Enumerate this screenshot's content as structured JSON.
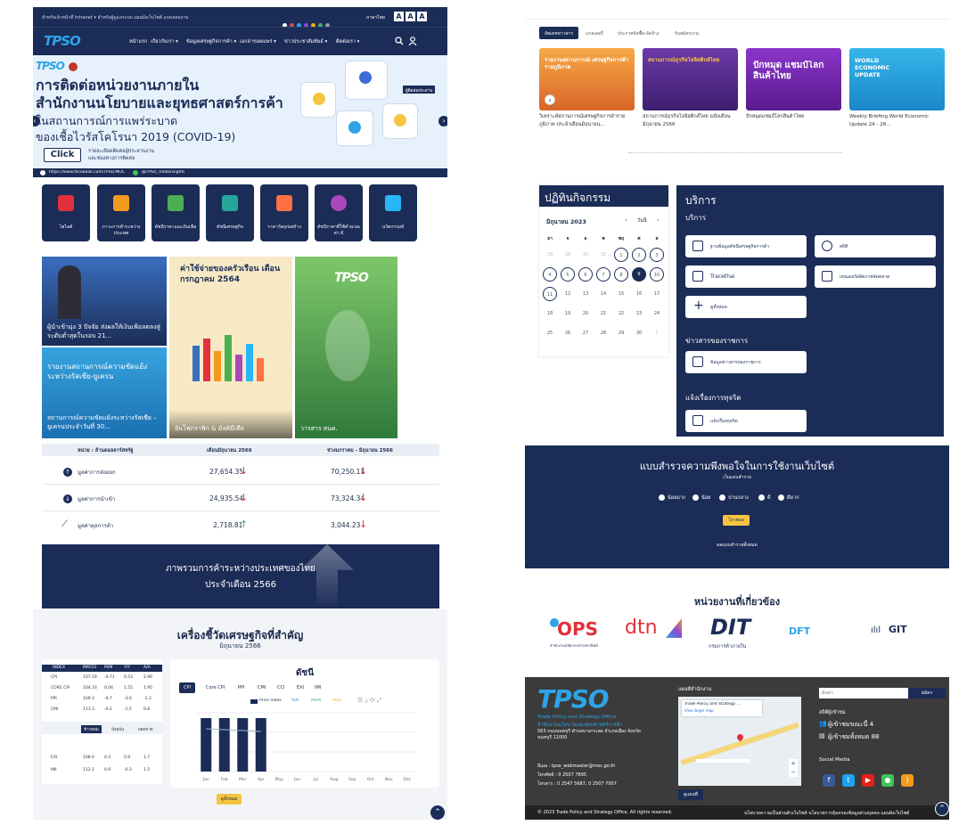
{
  "left": {
    "topbar": {
      "links": "สำหรับเจ้าหน้าที่ Intranet  ▾  สำหรับผู้ดูแลระบบ  แผนผังเว็บไซต์  แบบสอบถาม",
      "lang": "ภาษาไทย",
      "size_a1": "A",
      "size_a2": "A",
      "size_a3": "A"
    },
    "nav": {
      "logo": "TPSO",
      "items": [
        "หน้าแรก",
        "เกี่ยวกับเรา ▾",
        "ข้อมูลเศรษฐกิจการค้า ▾",
        "เอกสารเผยแพร่ ▾",
        "ข่าวประชาสัมพันธ์ ▾",
        "ติดต่อเรา ▾"
      ]
    },
    "hero": {
      "logo": "TPSO",
      "line1": "การติดต่อหน่วยงานภายใน",
      "line2": "สำนักงานนโยบายและยุทธศาสตร์การค้า",
      "line3": "ในสถานการณ์การแพร่ระบาด",
      "line4": "ของเชื้อไวรัสโคโรนา 2019 (COVID-19)",
      "click": "Click",
      "click_desc1": "รายละเอียดติดต่อผู้ประสานงาน",
      "click_desc2": "และช่องทางการติดต่อ",
      "facebook": "https://www.facebook.com/TPSO.MOC",
      "line": "@TPSO_Tradeinsights",
      "badge": "ผู้ติดต่อประสาน"
    },
    "quick_links": [
      {
        "label": "ไฮไลต์",
        "color": "#e0313c"
      },
      {
        "label": "ภาวะการค้าระหว่างประเทศ",
        "color": "#f29a1f"
      },
      {
        "label": "ดัชนีราคาและเงินเฟ้อ",
        "color": "#4caf50"
      },
      {
        "label": "ดัชนีเศรษฐกิจ",
        "color": "#26a69a"
      },
      {
        "label": "ราคาวัตถุก่อสร้าง",
        "color": "#ff7043"
      },
      {
        "label": "ดัชนีราคาที่ใช้คำนวณค่า K",
        "color": "#ab47bc"
      },
      {
        "label": "นวัตกรรมห์",
        "color": "#29b6f6"
      }
    ],
    "news": {
      "n1_title": "ผู้นำเข้ามุ่ง 3 ปัจจัย ส่งผลให้เงินเฟ้อลดลงสู่ระดับต่ำสุดในรอบ 21...",
      "n2_title": "สถานการณ์ความขัดแย้งระหว่างรัสเซีย – ยูเครนประจำวันที่ 30...",
      "n2_head": "รายงานสถานการณ์ความขัดแย้งระหว่างรัสเซีย-ยูเครน",
      "n3_title": "อินโฟกราฟิก & มัลติมีเดีย",
      "n3_head": "ค่าใช้จ่ายของครัวเรือน เดือนกรกฎาคม 2564",
      "n4_title": "วารสาร สนค.",
      "n4_logo": "TPSO"
    },
    "trade_table": {
      "unit": "หน่วย : ล้านดอลลาร์สหรัฐ",
      "col1": "เดือนมิถุนายน 2566",
      "col2": "ช่วงมกราคม - มิถุนายน 2566",
      "rows": [
        {
          "label": "มูลค่าการส่งออก",
          "v1": "27,654.35",
          "v2": "70,250.11",
          "d1": "down",
          "d2": "down"
        },
        {
          "label": "มูลค่าการนำเข้า",
          "v1": "24,935.54",
          "v2": "73,324.34",
          "d1": "down",
          "d2": "down"
        },
        {
          "label": "มูลค่าดุลการค้า",
          "v1": "2,718.81",
          "v2": "3,044.23",
          "d1": "up",
          "d2": "down"
        }
      ]
    },
    "banner2": {
      "line1": "ภาพรวมการค้าระหว่างประเทศของไทย",
      "line2": "ประจำเดือน 2566"
    },
    "econ": {
      "title": "เครื่องชี้วัดเศรษฐกิจที่สำคัญ",
      "subtitle": "มิถุนายน 2566",
      "index_title": "ดัชนี",
      "tabs": [
        "CPI",
        "Core CPI",
        "PPI",
        "CMI",
        "CCI",
        "EXI",
        "IMI"
      ],
      "legend": [
        "Price Index",
        "YOY",
        "MOM",
        "AOA"
      ],
      "months": [
        "Jan",
        "Feb",
        "Mar",
        "Apr",
        "May",
        "Jun",
        "Jul",
        "Aug",
        "Sep",
        "Oct",
        "Nov",
        "Dec"
      ],
      "more": "ดูทั้งหมด",
      "mini_headers": [
        "INDEX",
        "MAY23",
        "M/M",
        "Y/Y",
        "A/A"
      ],
      "mini_rows": [
        [
          "CPI",
          "107.19",
          "-0.71",
          "0.53",
          "2.96"
        ],
        [
          "CORE CPI",
          "104.33",
          "0.06",
          "1.55",
          "1.95"
        ],
        [
          "PPI",
          "109.3",
          "-0.7",
          "-3.0",
          "-1.3"
        ],
        [
          "CMI",
          "113.3",
          "-0.2",
          "-1.5",
          "0.8"
        ]
      ],
      "mini_tabs": [
        "ข้าวหอม",
        "ปัจจุบัน",
        "ยอดขาย"
      ],
      "mini_rows2": [
        [
          "EXI",
          "108.0",
          "0.4",
          "0.9",
          "1.7"
        ],
        [
          "IMI",
          "112.1",
          "0.9",
          "-0.3",
          "1.5"
        ]
      ]
    }
  },
  "right": {
    "tabs": [
      "อัพเดทข่าวสาร",
      "แกลเลอรี่",
      "ประกาศจัดซื้อ-จัดจ้าง",
      "รับสมัครงาน"
    ],
    "cards": [
      {
        "title": "วิเคราะห์สถานการณ์เศรษฐกิจการค้ารายภูมิภาค ประจำเดือนมิถุนายน...",
        "img_text": "รายงานสถานการณ์ เศรษฐกิจการค้ารายภูมิภาค",
        "color": "#f28b2e"
      },
      {
        "title": "สถานการณ์ธุรกิจโลจิสติกส์ไทย ฉบับเดือนมิถุนายน 2566",
        "img_text": "สถานการณ์ธุรกิจโลจิสติกส์ไทย",
        "color": "#5b2d8e"
      },
      {
        "title": "ปักหมุดแชมป์โลกสินค้าไทย",
        "img_text": "ปักหมุด แชมป์โลก สินค้าไทย",
        "color": "#7b2bb5"
      },
      {
        "title": "Weekly Briefing World Economic Update 24 - 28...",
        "img_text": "WORLD ECONOMIC UPDATE",
        "color": "#2aa7e0"
      }
    ],
    "calendar": {
      "title": "ปฏิทินกิจกรรม",
      "month": "มิถุนายน 2023",
      "today": "วันนี้",
      "dows": [
        "อา",
        "จ",
        "อ",
        "พ",
        "พฤ",
        "ศ",
        "ส"
      ],
      "days": [
        "28",
        "29",
        "30",
        "31",
        "1",
        "2",
        "3",
        "4",
        "5",
        "6",
        "7",
        "8",
        "9",
        "10",
        "11",
        "12",
        "13",
        "14",
        "15",
        "16",
        "17",
        "18",
        "19",
        "20",
        "21",
        "22",
        "23",
        "24",
        "25",
        "26",
        "27",
        "28",
        "29",
        "30",
        "1"
      ]
    },
    "services": {
      "title": "บริการ",
      "sub1": "บริการ",
      "items": [
        "ฐานข้อมูลดัชนีเศรษฐกิจการค้า",
        "สถิติ",
        "Tracethai",
        "เทนเดอร์ผลิตภาพจัดตลาด",
        "ดูทั้งหมด"
      ],
      "sub2": "ข่าวสารของราชการ",
      "item2": "ข้อมูลข่าวสารของราชการ",
      "sub3": "แจ้งเรื่องการทุจริต",
      "item3": "แจ้งเรื่องทุจริต"
    },
    "survey": {
      "title": "แบบสำรวจความพึงพอใจในการใช้งานเว็บไซต์",
      "subtitle": "เว็บแบบสำรวจ",
      "options": [
        "น้อยมาก",
        "น้อย",
        "ปานกลาง",
        "ดี",
        "ดีมาก"
      ],
      "submit": "โหวตผล",
      "result": "ผลแบบสำรวจทั้งหมด"
    },
    "partners": {
      "title": "หน่วยงานที่เกี่ยวข้อง",
      "logos": [
        "OPS",
        "dtn",
        "DIT",
        "DFT",
        "GIT"
      ],
      "ops_caption": "สำนักงานปลัดกระทรวงพาณิชย์",
      "dit_caption": "กรมการค้าภายใน"
    },
    "footer": {
      "logo": "TPSO",
      "org_en": "Trade Policy and Strategy Office",
      "org_th": "สำนักงานนโยบายและยุทธศาสตร์การค้า",
      "address": "563 ถนนนนทบุรี ตำบลบางกระสอ อำเภอเมือง จังหวัดนนทบุรี 11000",
      "email": "อีเมล : tpso_webmaster@moc.go.th",
      "phone": "โทรศัพท์ : 0 2507 7895",
      "fax": "โทรสาร : 0 2547 5687, 0 2507 7007",
      "map_title": "แผนที่สำนักงาน",
      "map_place": "Trade Policy and Strategy ...",
      "map_link": "View larger map",
      "map_btn": "ดูแผนที่",
      "search_placeholder": "ค้นหา",
      "subscribe": "สมัคร",
      "stats_title": "สถิติผู้เข้าชม",
      "online": "ผู้เข้าชมขณะนี้ 4",
      "total": "ผู้เข้าชมทั้งหมด 88",
      "social": "Social Media",
      "copyright": "© 2023 Trade Policy and Strategy Office. All rights reserved.",
      "links": "นโยบายความเป็นส่วนตัวเว็บไซต์  นโยบายการคุ้มครองข้อมูลส่วนบุคคล  แผนผังเว็บไซต์"
    }
  }
}
